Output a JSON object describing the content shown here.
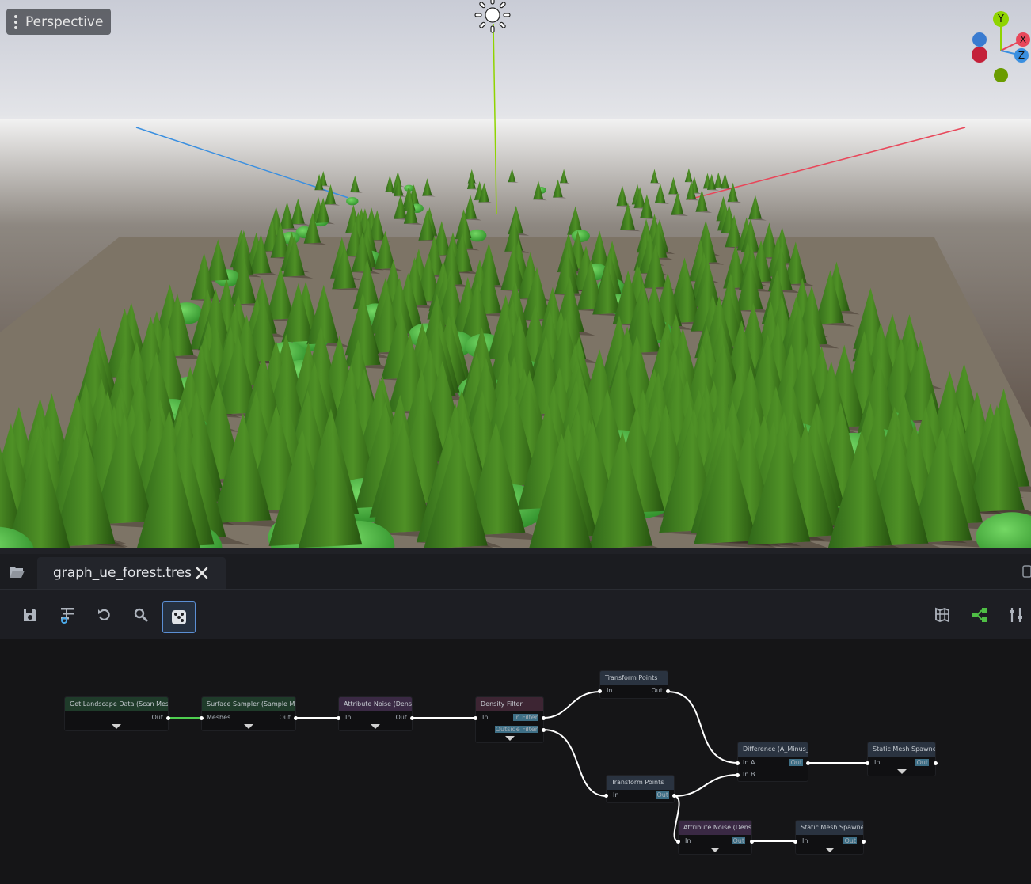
{
  "viewport": {
    "mode_label": "Perspective",
    "gizmo": {
      "x_label": "X",
      "y_label": "Y",
      "z_label": "Z"
    },
    "colors": {
      "x_axis": "#e8475a",
      "y_axis": "#8fd400",
      "z_axis": "#3a8fe0",
      "ground": "#7d7466",
      "tree": "#3f7a22",
      "bush": "#4fbf45"
    }
  },
  "editor": {
    "tab": {
      "title": "graph_ue_forest.tres"
    },
    "toolbar_left": [
      {
        "name": "save-icon"
      },
      {
        "name": "graph-options-icon"
      },
      {
        "name": "undo-icon"
      },
      {
        "name": "search-icon"
      },
      {
        "name": "randomize-dice-icon",
        "active": true
      }
    ],
    "toolbar_right": [
      {
        "name": "inspector-icon"
      },
      {
        "name": "graph-nodes-icon"
      },
      {
        "name": "settings-tools-icon"
      }
    ]
  },
  "graph": {
    "nodes": [
      {
        "id": "n1",
        "title": "Get Landscape Data (Scan Meshes)",
        "color": "#1f3b2a",
        "inputs": [],
        "outputs": [
          "Out"
        ]
      },
      {
        "id": "n2",
        "title": "Surface Sampler (Sample Mesh)",
        "color": "#1f3b2a",
        "inputs": [
          "Meshes"
        ],
        "outputs": [
          "Out"
        ]
      },
      {
        "id": "n3",
        "title": "Attribute Noise (Density)",
        "color": "#3a2944",
        "inputs": [
          "In"
        ],
        "outputs": [
          "Out"
        ]
      },
      {
        "id": "n4",
        "title": "Density Filter",
        "color": "#3d2533",
        "inputs": [
          "In"
        ],
        "outputs": [
          "In Filter",
          "Outside Filter"
        ]
      },
      {
        "id": "n5",
        "title": "Transform Points",
        "color": "#2a3340",
        "inputs": [
          "In"
        ],
        "outputs": [
          "Out"
        ]
      },
      {
        "id": "n6",
        "title": "Transform Points",
        "color": "#2a3340",
        "inputs": [
          "In"
        ],
        "outputs": [
          "Out"
        ]
      },
      {
        "id": "n7",
        "title": "Difference (A_Minus_B)",
        "color": "#2a3340",
        "inputs": [
          "In A",
          "In B"
        ],
        "outputs": [
          "Out"
        ]
      },
      {
        "id": "n8",
        "title": "Static Mesh Spawner",
        "color": "#2a3340",
        "inputs": [
          "In"
        ],
        "outputs": [
          "Out"
        ]
      },
      {
        "id": "n9",
        "title": "Attribute Noise (Density)",
        "color": "#3a2944",
        "inputs": [
          "In"
        ],
        "outputs": [
          "Out"
        ]
      },
      {
        "id": "n10",
        "title": "Static Mesh Spawner",
        "color": "#2a3340",
        "inputs": [
          "In"
        ],
        "outputs": [
          "Out"
        ]
      }
    ]
  }
}
